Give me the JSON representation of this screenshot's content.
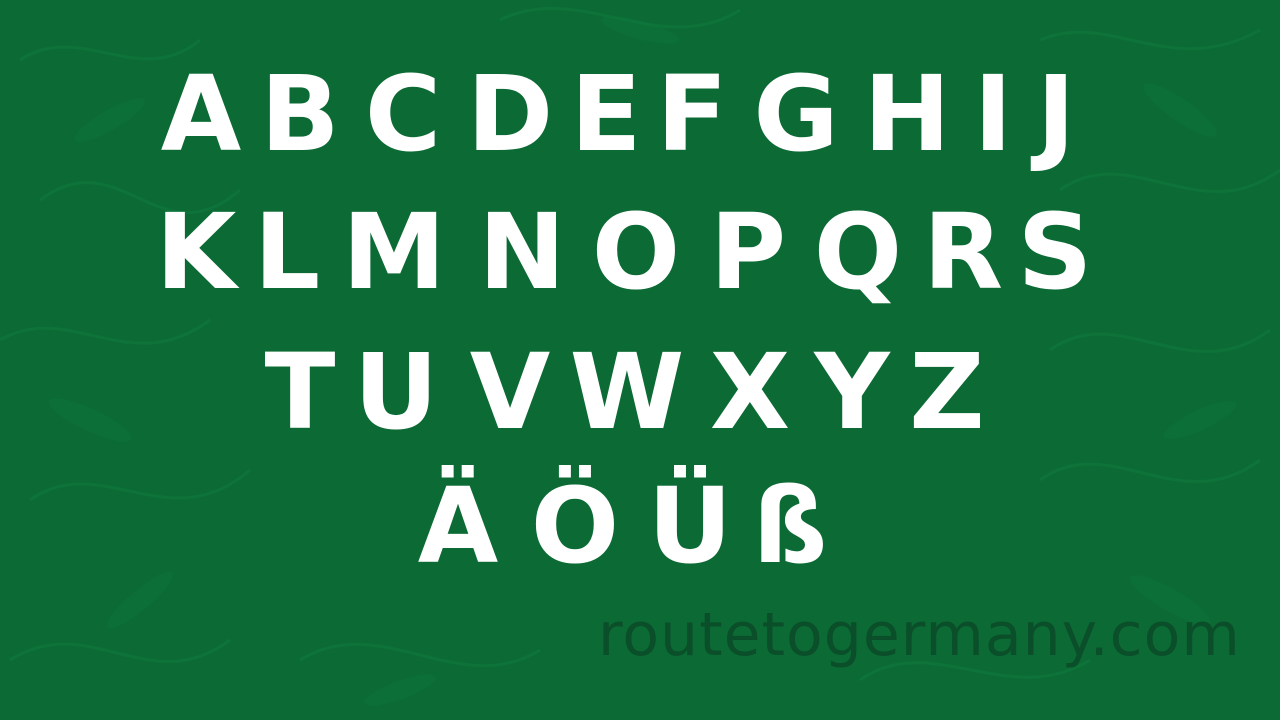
{
  "background_color": "#0c6b35",
  "text_color": "#ffffff",
  "watermark_color": "#0a4f29",
  "rows": [
    [
      "A",
      "B",
      "C",
      "D",
      "E",
      "F",
      "G",
      "H",
      "I",
      "J"
    ],
    [
      "K",
      "L",
      "M",
      "N",
      "O",
      "P",
      "Q",
      "R",
      "S"
    ],
    [
      "T",
      "U",
      "V",
      "W",
      "X",
      "Y",
      "Z"
    ],
    [
      "Ä",
      "Ö",
      "Ü",
      "ß"
    ]
  ],
  "watermark": "routetogermany.com"
}
